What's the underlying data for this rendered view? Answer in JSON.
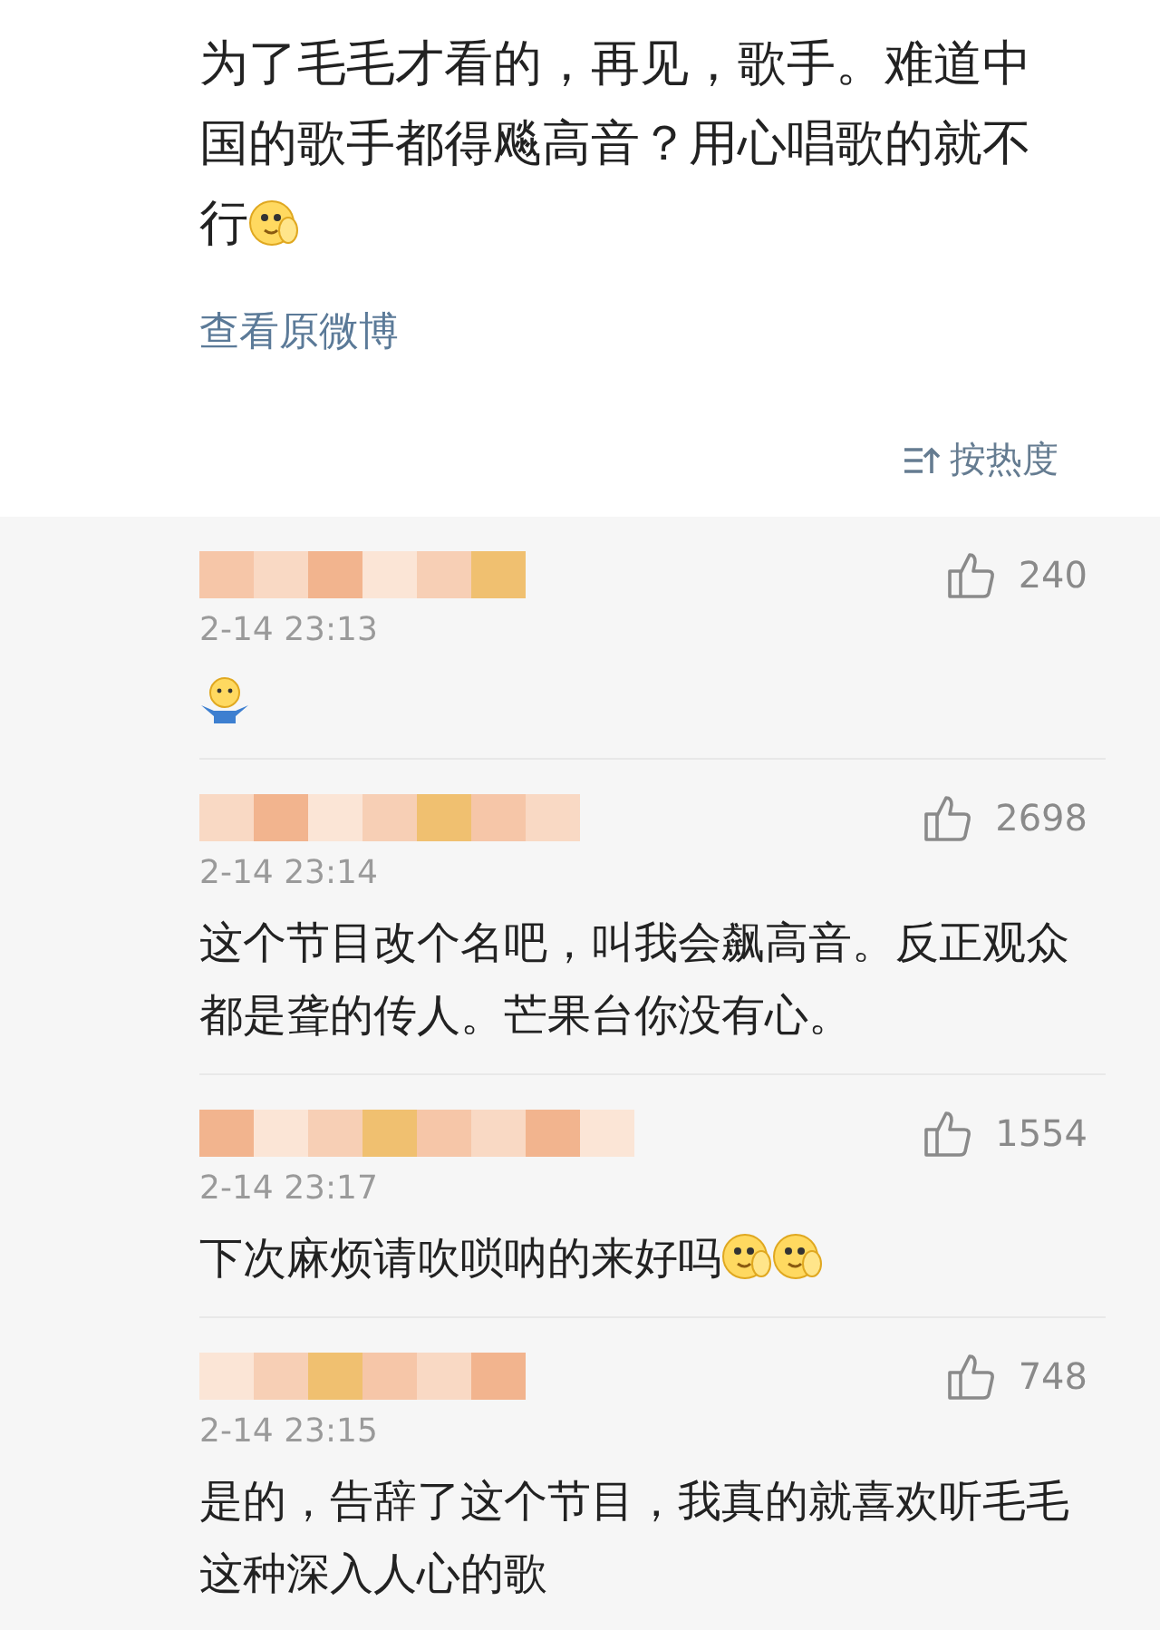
{
  "post": {
    "text": "为了毛毛才看的，再见，歌手。难道中国的歌手都得飚高音？用心唱歌的就不行",
    "emojis": [
      {
        "kind": "cover-face"
      }
    ],
    "link": "查看原微博"
  },
  "sort": {
    "label": "按热度"
  },
  "comments": [
    {
      "time": "2-14 23:13",
      "likes": "240",
      "emojis": [
        {
          "kind": "shrug"
        }
      ]
    },
    {
      "time": "2-14 23:14",
      "likes": "2698",
      "text": "这个节目改个名吧，叫我会飙高音。反正观众都是聋的传人。芒果台你没有心。"
    },
    {
      "time": "2-14 23:17",
      "likes": "1554",
      "text": "下次麻烦请吹唢呐的来好吗",
      "emojis": [
        {
          "kind": "cover-face"
        },
        {
          "kind": "cover-face"
        }
      ]
    },
    {
      "time": "2-14 23:15",
      "likes": "748",
      "text": "是的，告辞了这个节目，我真的就喜欢听毛毛这种深入人心的歌"
    }
  ]
}
